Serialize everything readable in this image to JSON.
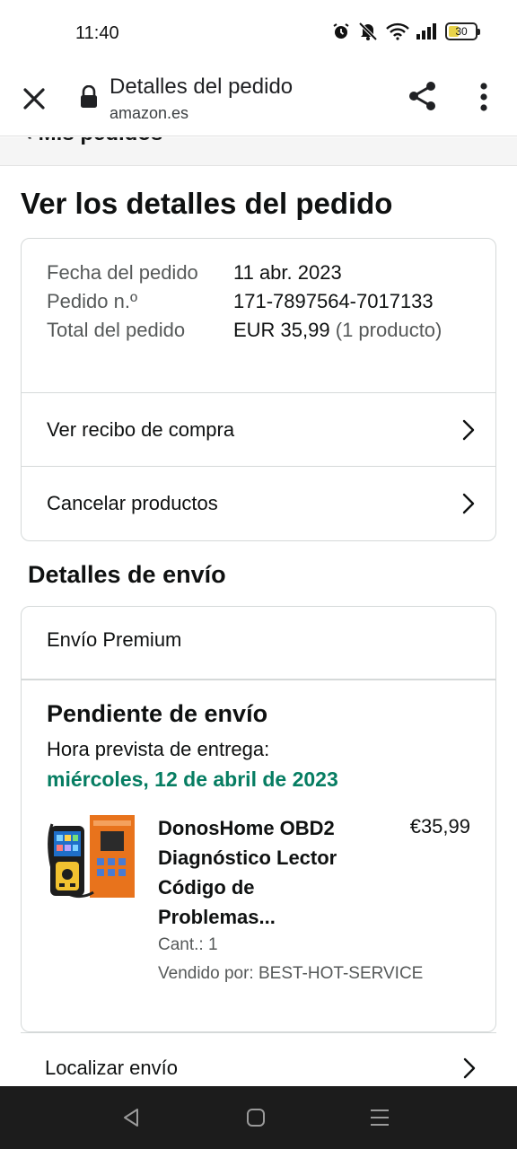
{
  "status_bar": {
    "time": "11:40",
    "battery": "30",
    "icons": [
      "alarm-icon",
      "mute-icon",
      "wifi-icon",
      "signal-icon",
      "battery-icon"
    ]
  },
  "browser": {
    "title": "Detalles del pedido",
    "url": "amazon.es"
  },
  "breadcrumb": "‹ Mis pedidos",
  "page": {
    "title": "Ver los detalles del pedido"
  },
  "order_summary": {
    "date_label": "Fecha del pedido",
    "date_value": "11 abr. 2023",
    "number_label": "Pedido n.º",
    "number_value": "171-7897564-7017133",
    "total_label": "Total del pedido",
    "total_value": "EUR 35,99",
    "total_count": "(1 producto)",
    "receipt_link": "Ver recibo de compra",
    "cancel_link": "Cancelar productos"
  },
  "shipping": {
    "section_title": "Detalles de envío",
    "method": "Envío Premium",
    "status": "Pendiente de envío",
    "eta_label": "Hora prevista de entrega:",
    "eta_date": "miércoles, 12 de abril de 2023",
    "product": {
      "name": "DonosHome OBD2 Diagnóstico Lector Código de Problemas...",
      "price": "€35,99",
      "quantity": "Cant.: 1",
      "seller": "Vendido por: BEST-HOT-SERVICE"
    },
    "track_link": "Localizar envío"
  },
  "colors": {
    "eta_green": "#067d62",
    "border": "#d5d9d9",
    "muted_text": "#565959"
  }
}
